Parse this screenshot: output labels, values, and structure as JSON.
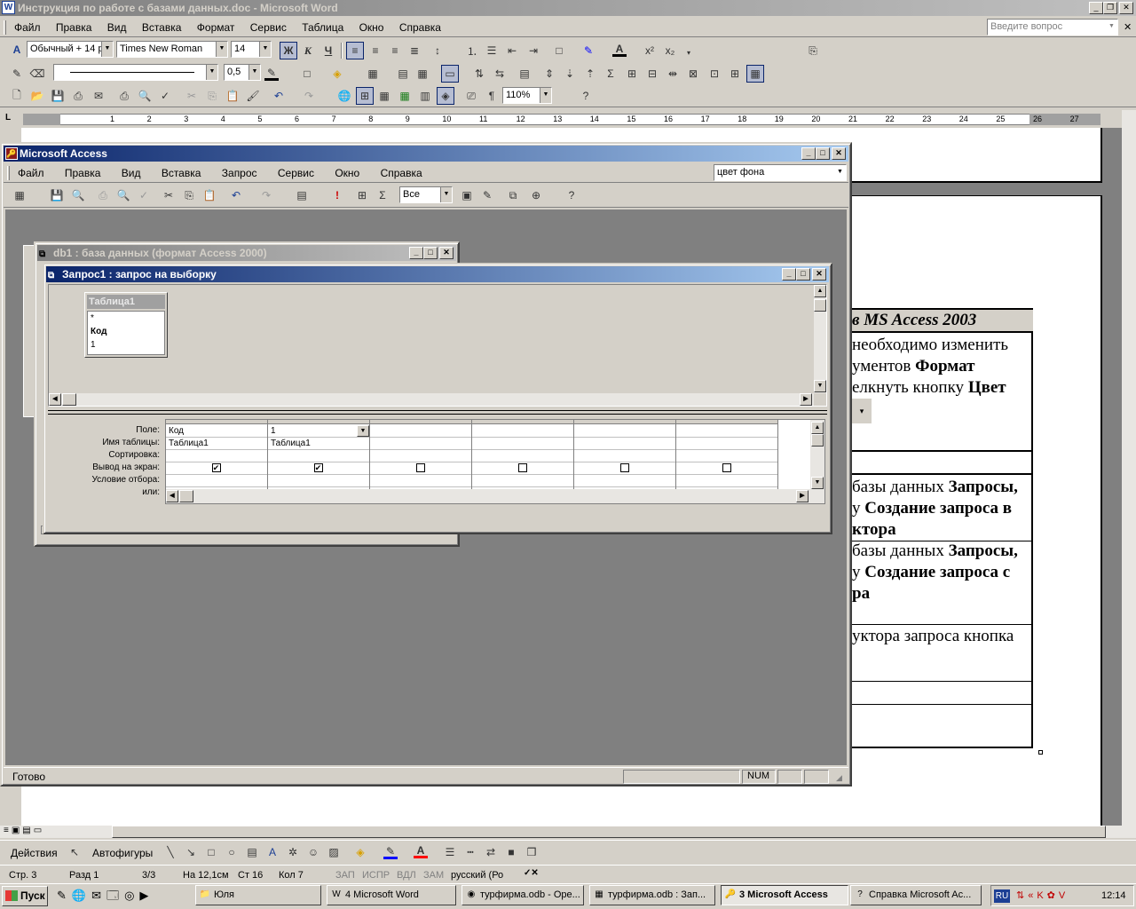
{
  "word": {
    "title": "Инструкция по работе с базами данных.doc - Microsoft Word",
    "menu": [
      "Файл",
      "Правка",
      "Вид",
      "Вставка",
      "Формат",
      "Сервис",
      "Таблица",
      "Окно",
      "Справка"
    ],
    "help_placeholder": "Введите вопрос",
    "style": "Обычный + 14 р",
    "font": "Times New Roman",
    "size": "14",
    "bold": "Ж",
    "italic": "К",
    "underline": "Ч",
    "line_width": "0,5",
    "zoom": "110%",
    "ruler_numbers": [
      "1",
      "2",
      "3",
      "4",
      "5",
      "6",
      "7",
      "8",
      "9",
      "10",
      "11",
      "12",
      "13",
      "14",
      "15",
      "16",
      "17",
      "18",
      "19",
      "20",
      "21",
      "22",
      "23",
      "24",
      "25",
      "26",
      "27"
    ],
    "doc": {
      "header": "в MS Access 2003",
      "lines": [
        [
          "необходимо изменить",
          ""
        ],
        [
          "ументов ",
          "Формат"
        ],
        [
          "елкнуть кнопку ",
          "Цвет"
        ],
        [
          "базы данных ",
          "Запросы,"
        ],
        [
          "у ",
          "Создание запроса в"
        ],
        [
          "",
          "ктора"
        ],
        [
          "базы данных ",
          "Запросы,"
        ],
        [
          "у ",
          "Создание запроса с"
        ],
        [
          "",
          "ра"
        ],
        [
          "уктора запроса кнопка",
          ""
        ]
      ]
    },
    "statusbar": {
      "page": "Стр. 3",
      "section": "Разд 1",
      "pages": "3/3",
      "at": "На 12,1см",
      "line": "Ст 16",
      "col": "Кол 7",
      "rec": "ЗАП",
      "trk": "ИСПР",
      "ext": "ВДЛ",
      "ovr": "ЗАМ",
      "lang": "русский (Ро"
    },
    "drawing": {
      "actions": "Действия",
      "autoshapes": "Автофигуры"
    }
  },
  "access": {
    "title": "Microsoft Access",
    "menu": [
      "Файл",
      "Правка",
      "Вид",
      "Вставка",
      "Запрос",
      "Сервис",
      "Окно",
      "Справка"
    ],
    "help_value": "цвет фона",
    "top_values": "Все",
    "status": "Готово",
    "num": "NUM",
    "db_window_title": "db1 : база данных (формат Access 2000)",
    "query": {
      "title": "Запрос1 : запрос на выборку",
      "table_name": "Таблица1",
      "fields": [
        "*",
        "Код",
        "1"
      ],
      "row_labels": [
        "Поле:",
        "Имя таблицы:",
        "Сортировка:",
        "Вывод на экран:",
        "Условие отбора:",
        "или:"
      ],
      "columns": [
        {
          "field": "Код",
          "table": "Таблица1",
          "show": true
        },
        {
          "field": "1",
          "table": "Таблица1",
          "show": true
        },
        {
          "field": "",
          "table": "",
          "show": false
        },
        {
          "field": "",
          "table": "",
          "show": false
        },
        {
          "field": "",
          "table": "",
          "show": false
        },
        {
          "field": "",
          "table": "",
          "show": false
        }
      ]
    }
  },
  "taskbar": {
    "start": "Пуск",
    "items": [
      {
        "label": "Юля",
        "icon": "folder-icon"
      },
      {
        "label": "4 Microsoft Word",
        "icon": "word-icon"
      },
      {
        "label": "турфирма.odb - Ope...",
        "icon": "oo-icon"
      },
      {
        "label": "турфирма.odb : Зап...",
        "icon": "table-icon"
      },
      {
        "label": "3 Microsoft Access",
        "icon": "access-icon",
        "active": true
      },
      {
        "label": "Справка Microsoft Ac...",
        "icon": "help-icon"
      }
    ],
    "lang": "RU",
    "clock": "12:14"
  }
}
